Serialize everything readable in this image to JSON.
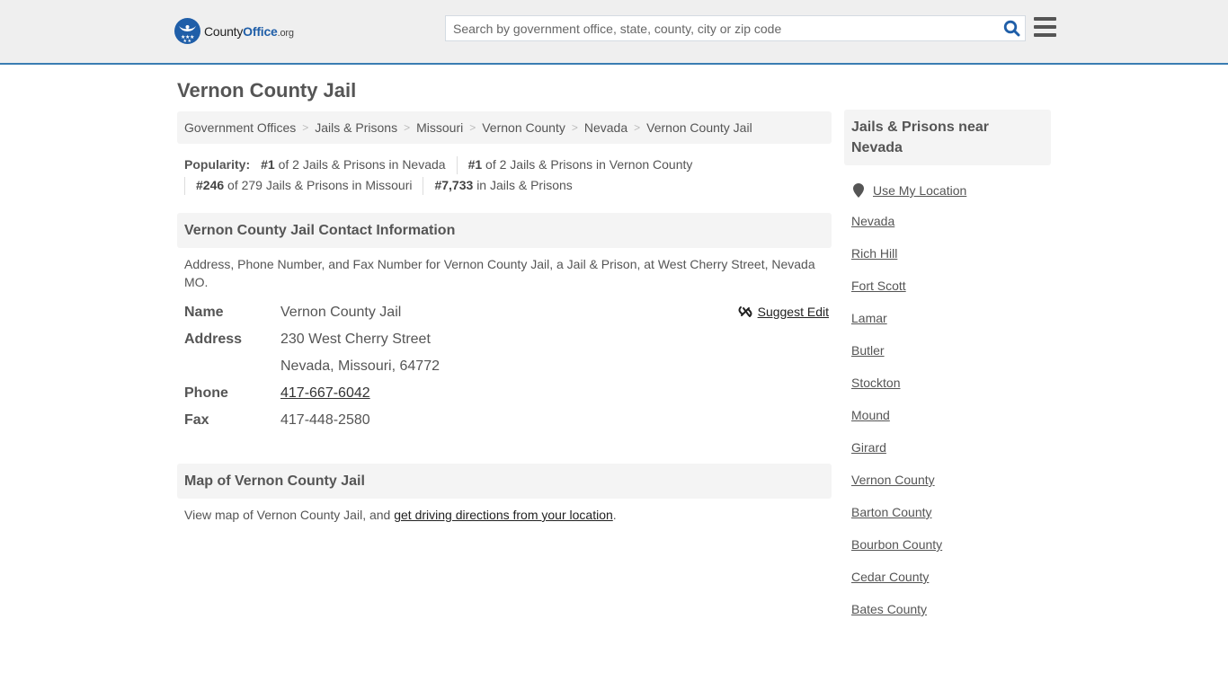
{
  "header": {
    "logo": {
      "county": "County",
      "office": "Office",
      "org": ".org"
    },
    "search": {
      "placeholder": "Search by government office, state, county, city or zip code",
      "value": ""
    },
    "icons": {
      "search": "search-icon",
      "menu": "hamburger-menu-icon"
    }
  },
  "page": {
    "title": "Vernon County Jail"
  },
  "breadcrumb": {
    "items": [
      "Government Offices",
      "Jails & Prisons",
      "Missouri",
      "Vernon County",
      "Nevada"
    ],
    "current": "Vernon County Jail",
    "separator": ">"
  },
  "popularity": {
    "label": "Popularity:",
    "ranks": [
      {
        "rank": "#1",
        "text": "of 2 Jails & Prisons in Nevada"
      },
      {
        "rank": "#1",
        "text": "of 2 Jails & Prisons in Vernon County"
      },
      {
        "rank": "#246",
        "text": "of 279 Jails & Prisons in Missouri"
      },
      {
        "rank": "#7,733",
        "text": "in Jails & Prisons"
      }
    ]
  },
  "contact": {
    "heading": "Vernon County Jail Contact Information",
    "description": "Address, Phone Number, and Fax Number for Vernon County Jail, a Jail & Prison, at West Cherry Street, Nevada MO.",
    "suggest_edit": "Suggest Edit",
    "fields": {
      "name_label": "Name",
      "name": "Vernon County Jail",
      "address_label": "Address",
      "address_line1": "230 West Cherry Street",
      "address_line2": "Nevada, Missouri, 64772",
      "phone_label": "Phone",
      "phone": "417-667-6042",
      "fax_label": "Fax",
      "fax": "417-448-2580"
    }
  },
  "map": {
    "heading": "Map of Vernon County Jail",
    "text": "View map of Vernon County Jail, and ",
    "link": "get driving directions from your location",
    "suffix": "."
  },
  "sidebar": {
    "heading": "Jails & Prisons near Nevada",
    "use_location": "Use My Location",
    "links": [
      "Nevada",
      "Rich Hill",
      "Fort Scott",
      "Lamar",
      "Butler",
      "Stockton",
      "Mound",
      "Girard",
      "Vernon County",
      "Barton County",
      "Bourbon County",
      "Cedar County",
      "Bates County"
    ]
  },
  "colors": {
    "accent": "#3a7db2",
    "brand": "#1f5ea8",
    "header_bg": "#efefef",
    "panel_bg": "#f4f4f4"
  }
}
